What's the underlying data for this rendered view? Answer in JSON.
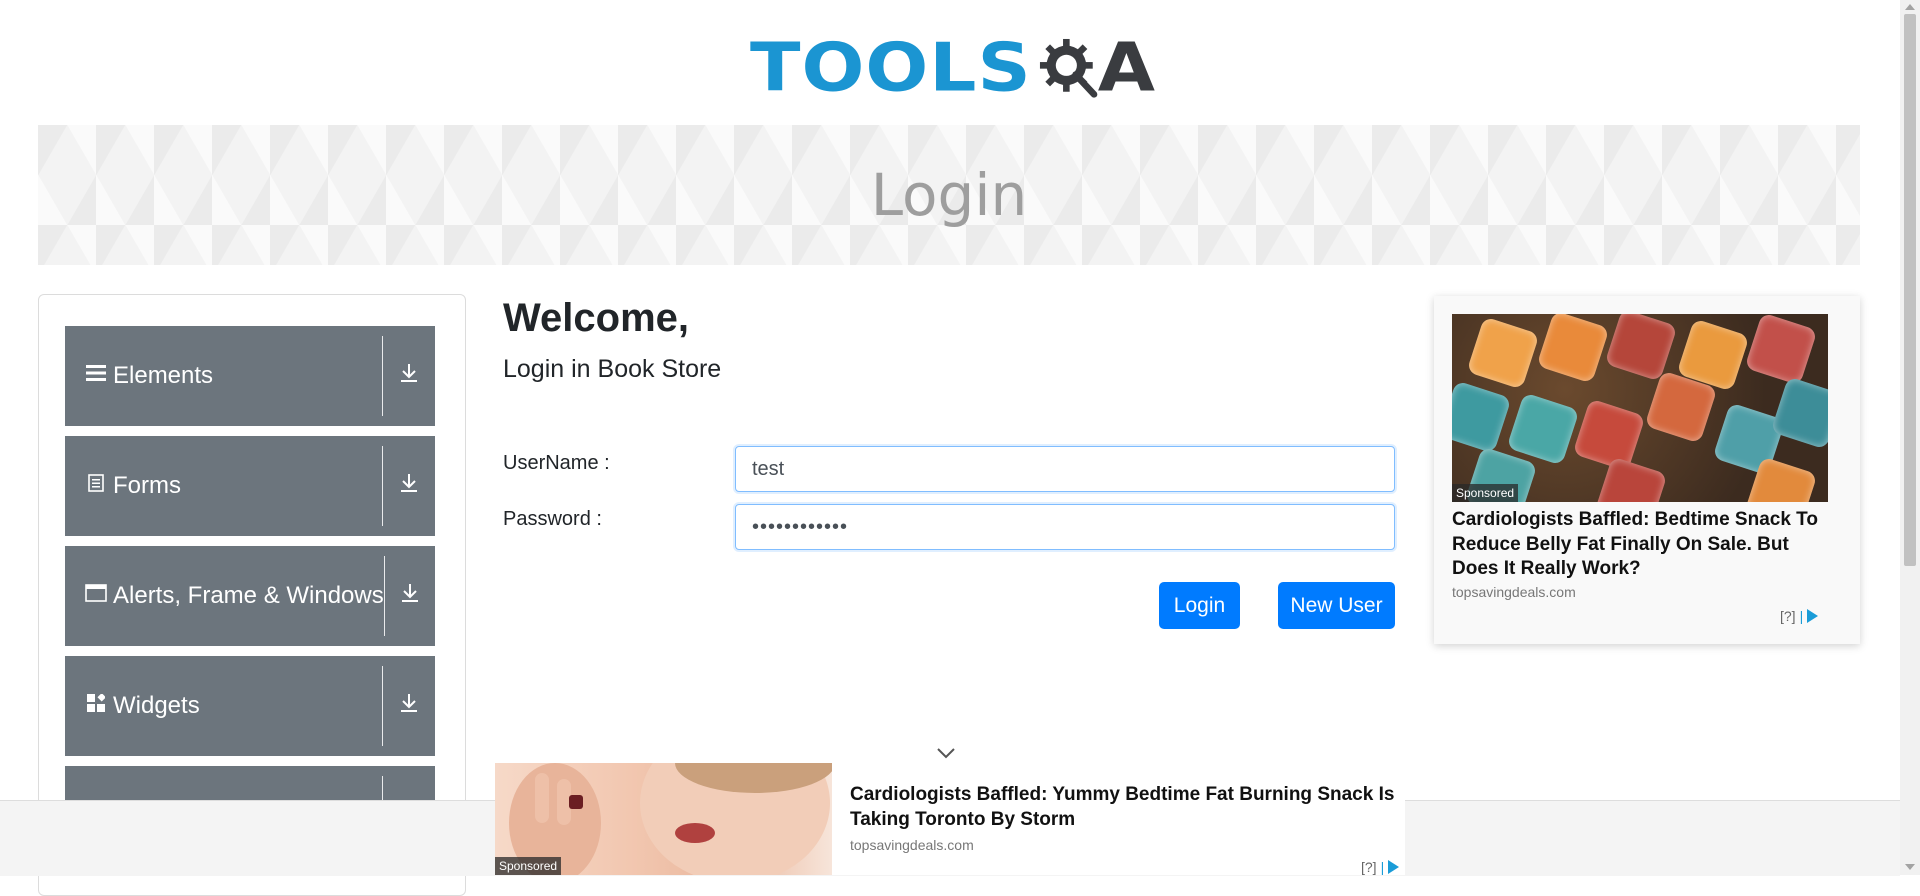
{
  "header": {
    "logo_left": "TOOLS",
    "logo_right": "A",
    "banner_title": "Login"
  },
  "sidebar": {
    "groups": [
      {
        "label": "Elements",
        "icon": "hamburger-icon"
      },
      {
        "label": "Forms",
        "icon": "document-icon"
      },
      {
        "label": "Alerts, Frame & Windows",
        "icon": "window-icon"
      },
      {
        "label": "Widgets",
        "icon": "widgets-icon"
      },
      {
        "label": "",
        "icon": ""
      }
    ],
    "expand_icon": "download-arrow-icon"
  },
  "main": {
    "welcome": "Welcome,",
    "subtitle": "Login in Book Store",
    "username_label": "UserName :",
    "username_value": "test",
    "password_label": "Password :",
    "password_value": "••••••••••••",
    "login_button": "Login",
    "new_user_button": "New User"
  },
  "ad_right": {
    "badge": "Sponsored",
    "headline": "Cardiologists Baffled: Bedtime Snack To Reduce Belly Fat Finally On Sale. But Does It Really Work?",
    "domain": "topsavingdeals.com",
    "info": "[?]"
  },
  "ad_bottom": {
    "badge": "Sponsored",
    "headline": "Cardiologists Baffled: Yummy Bedtime Fat Burning Snack Is Taking Toronto By Storm",
    "domain": "topsavingdeals.com",
    "info": "[?]"
  },
  "colors": {
    "accent": "#007bff",
    "sidebar_group": "#6c757d",
    "logo_blue": "#1b95d2",
    "logo_dark": "#3a3c40"
  }
}
